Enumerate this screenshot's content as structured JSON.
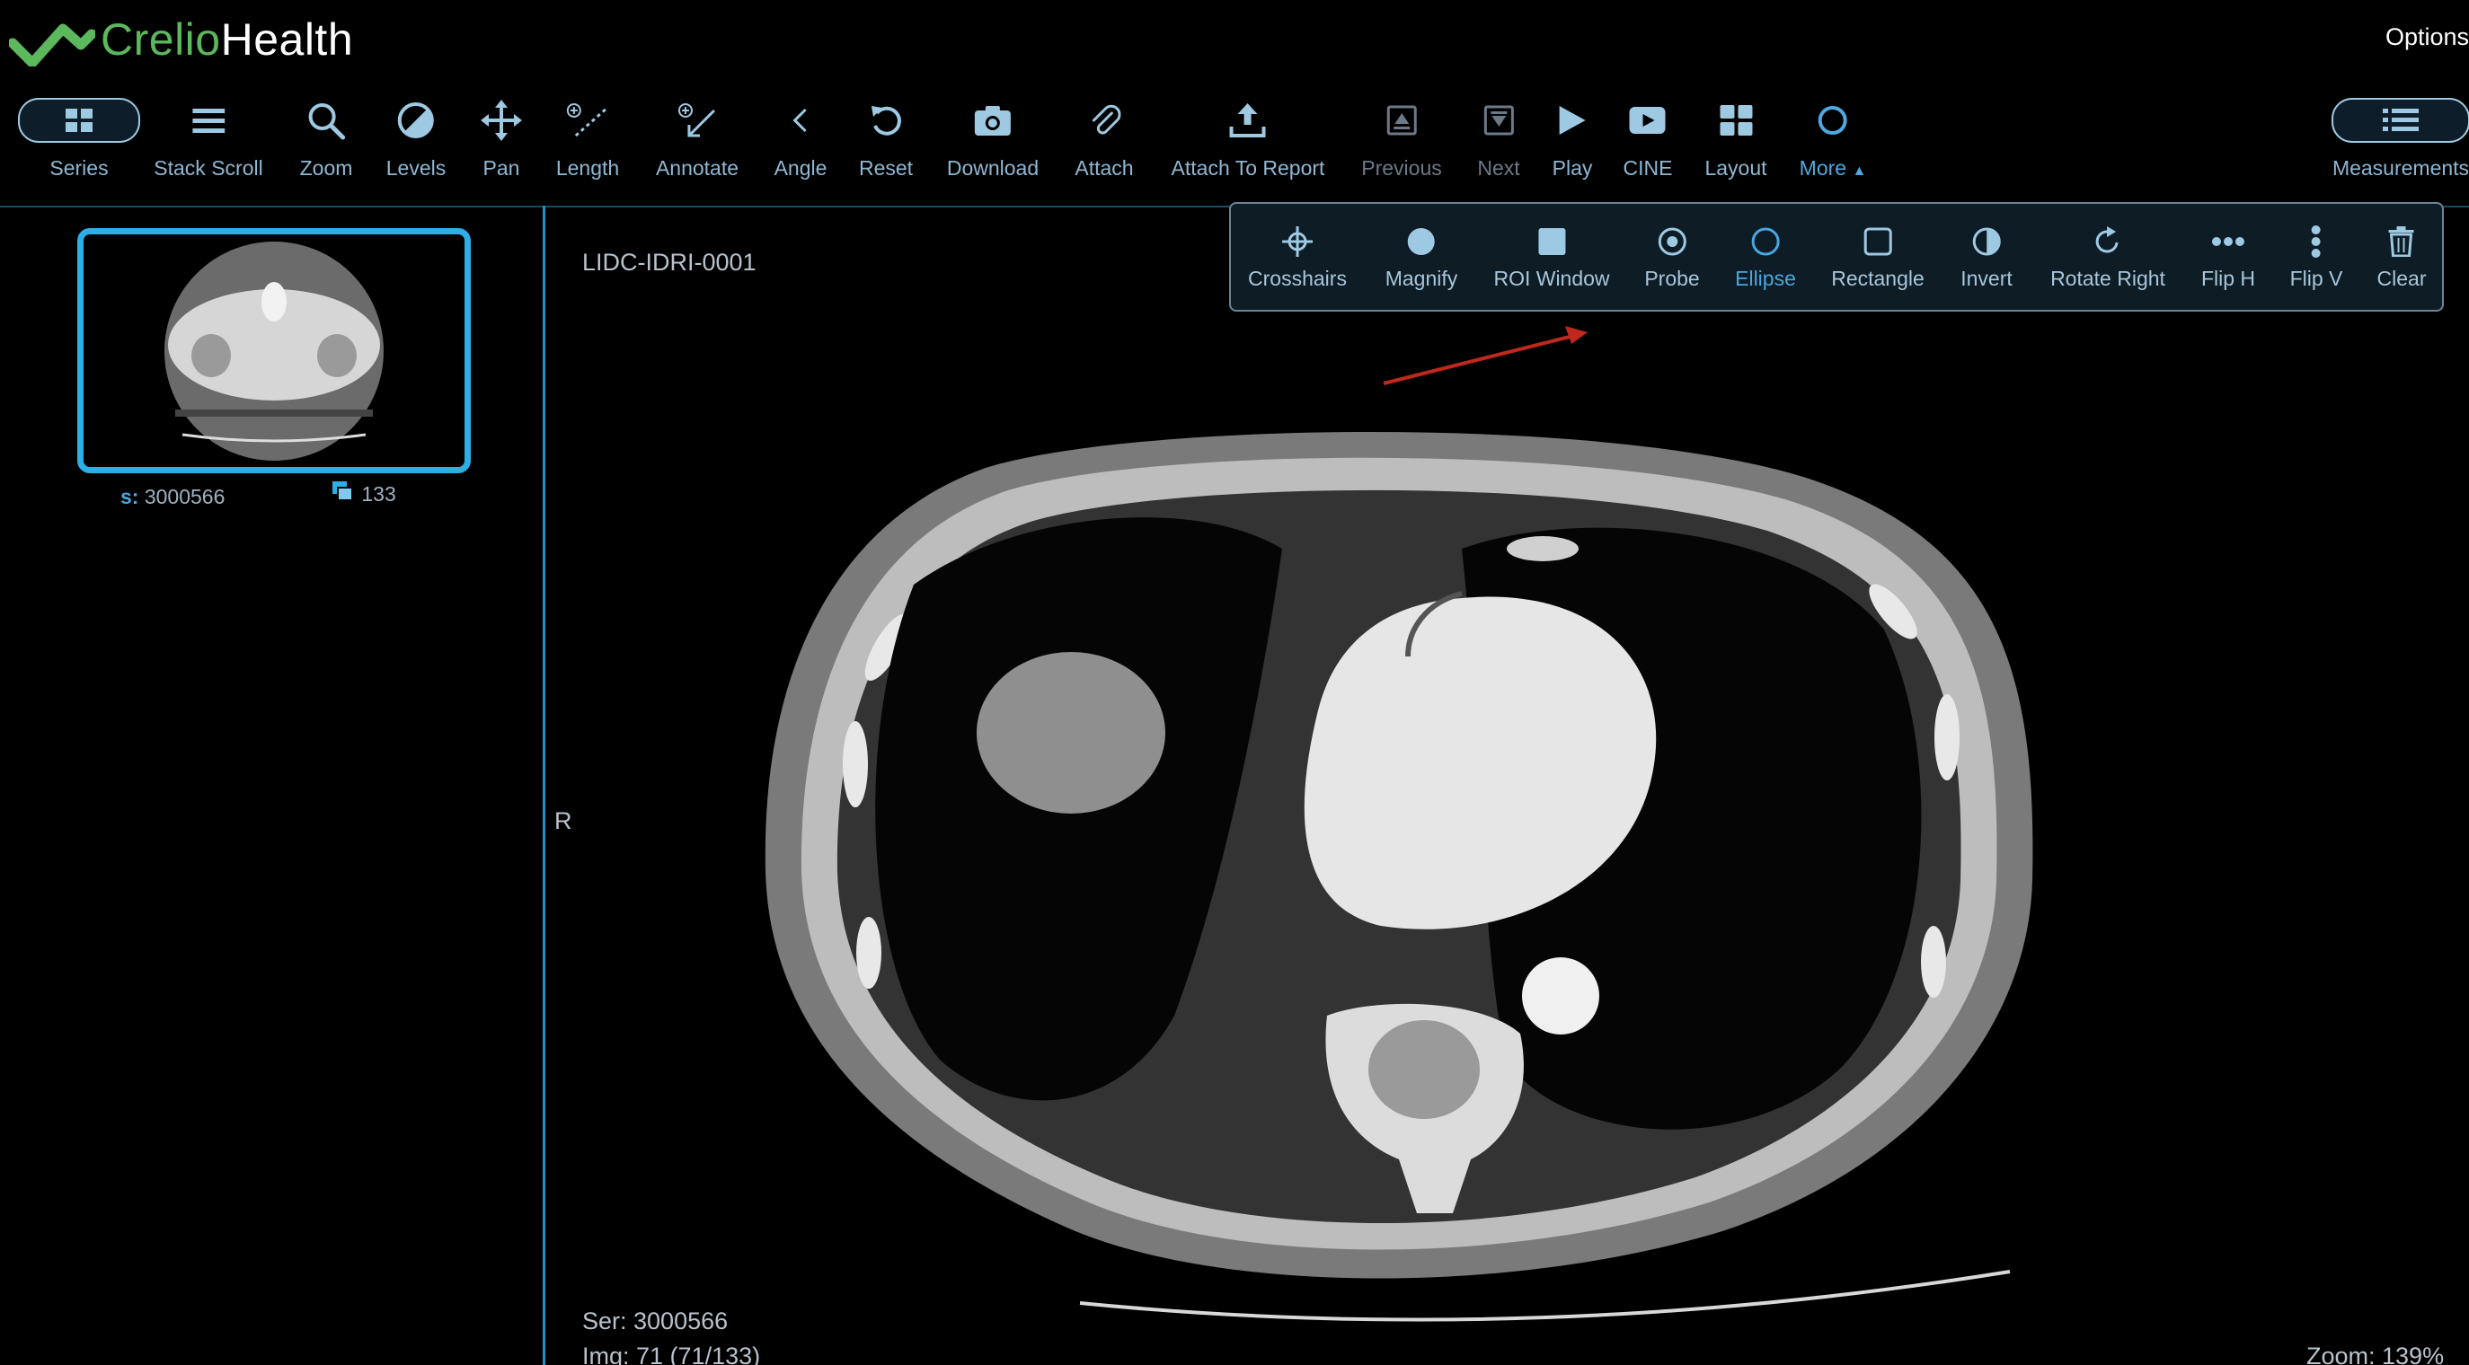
{
  "app": {
    "brand_part1": "Crelio",
    "brand_part2": "Health",
    "options_label": "Options"
  },
  "toolbar": {
    "series": "Series",
    "stack_scroll": "Stack Scroll",
    "zoom": "Zoom",
    "levels": "Levels",
    "pan": "Pan",
    "length": "Length",
    "annotate": "Annotate",
    "angle": "Angle",
    "reset": "Reset",
    "download": "Download",
    "attach": "Attach",
    "attach_to_report": "Attach To Report",
    "previous": "Previous",
    "next": "Next",
    "play": "Play",
    "cine": "CINE",
    "layout": "Layout",
    "more": "More",
    "measurements": "Measurements"
  },
  "more_menu": {
    "crosshairs": "Crosshairs",
    "magnify": "Magnify",
    "roi_window": "ROI Window",
    "probe": "Probe",
    "ellipse": "Ellipse",
    "rectangle": "Rectangle",
    "invert": "Invert",
    "rotate_right": "Rotate Right",
    "flip_h": "Flip H",
    "flip_v": "Flip V",
    "clear": "Clear"
  },
  "series_panel": {
    "series_prefix": "s:",
    "series_number": "3000566",
    "image_count": "133"
  },
  "viewport": {
    "patient_id": "LIDC-IDRI-0001",
    "orientation_marker": "R",
    "series_info": "Ser: 3000566",
    "image_info": "Img: 71 (71/133)",
    "zoom_info": "Zoom: 139%"
  },
  "colors": {
    "accent": "#2eaee6",
    "brand_green": "#5cb85c",
    "active_tool": "#4fa8e0"
  }
}
